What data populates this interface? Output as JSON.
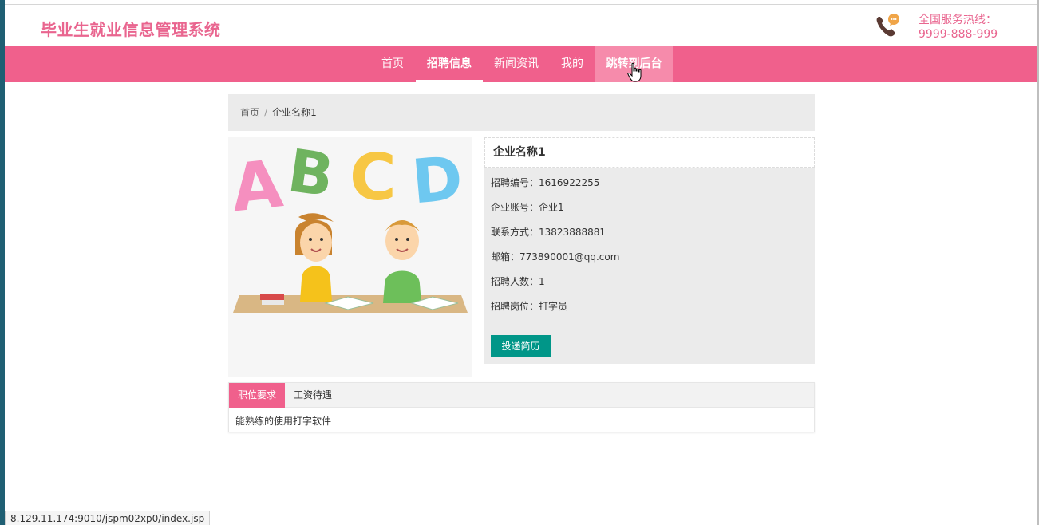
{
  "header": {
    "site_title": "毕业生就业信息管理系统",
    "hotline_label": "全国服务热线：",
    "hotline_number": "9999-888-999"
  },
  "nav": {
    "items": [
      {
        "label": "首页"
      },
      {
        "label": "招聘信息"
      },
      {
        "label": "新闻资讯"
      },
      {
        "label": "我的"
      },
      {
        "label": "跳转到后台"
      }
    ]
  },
  "breadcrumb": {
    "home": "首页",
    "separator": "/",
    "current": "企业名称1"
  },
  "detail": {
    "company_name": "企业名称1",
    "fields": [
      {
        "label": "招聘编号：",
        "value": "1616922255"
      },
      {
        "label": "企业账号：",
        "value": "企业1"
      },
      {
        "label": "联系方式：",
        "value": "13823888881"
      },
      {
        "label": "邮箱：",
        "value": "773890001@qq.com"
      },
      {
        "label": "招聘人数：",
        "value": "1"
      },
      {
        "label": "招聘岗位：",
        "value": "打字员"
      }
    ],
    "apply_button": "投递简历",
    "image_letters": [
      "A",
      "B",
      "C",
      "D"
    ]
  },
  "tabs": {
    "items": [
      {
        "label": "职位要求"
      },
      {
        "label": "工资待遇"
      }
    ],
    "active_content": "能熟练的使用打字软件"
  },
  "status_bar": {
    "url": "8.129.11.174:9010/jspm02xp0/index.jsp"
  },
  "colors": {
    "brand_pink": "#f0608c",
    "button_teal": "#009688"
  }
}
